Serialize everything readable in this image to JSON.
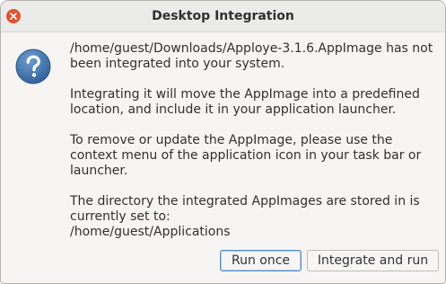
{
  "window": {
    "title": "Desktop Integration"
  },
  "icons": {
    "close": "close-icon",
    "question": "question-icon"
  },
  "colors": {
    "close_button": "#e4522f",
    "question_icon": "#3a6ea5",
    "default_button_border": "#5c8ec7"
  },
  "message": {
    "line1": "/home/guest/Downloads/Apploye-3.1.6.AppImage has not been integrated into your system.",
    "line2": "Integrating it will move the AppImage into a predefined location, and include it in your application launcher.",
    "line3": "To remove or update the AppImage, please use the context menu of the application icon in your task bar or launcher.",
    "line4": "The directory the integrated AppImages are stored in is currently set to:",
    "path": "/home/guest/Applications"
  },
  "buttons": {
    "run_once": "Run once",
    "integrate_and_run": "Integrate and run"
  }
}
